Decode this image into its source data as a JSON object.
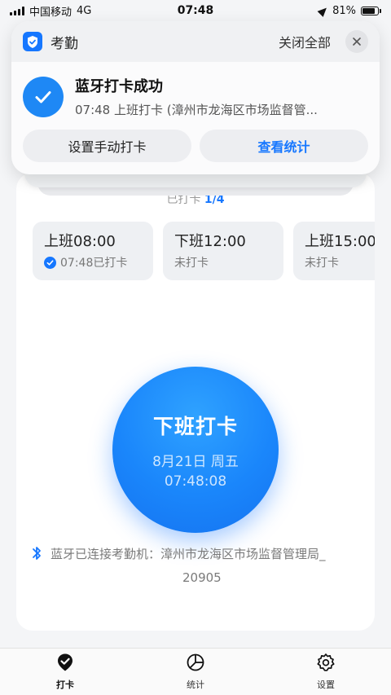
{
  "status_bar": {
    "carrier": "中国移动",
    "network": "4G",
    "time": "07:48",
    "battery": "81%",
    "battery_level": 0.81
  },
  "notification": {
    "app_name": "考勤",
    "close_all": "关闭全部",
    "title": "蓝牙打卡成功",
    "subtitle": "07:48 上班打卡 (漳州市龙海区市场监督管...",
    "button_manual": "设置手动打卡",
    "button_stats": "查看统计"
  },
  "main": {
    "progress_prefix": "已打卡",
    "progress_count": "1/4",
    "shifts": [
      {
        "time": "上班08:00",
        "status": "07:48已打卡",
        "done": true
      },
      {
        "time": "下班12:00",
        "status": "未打卡",
        "done": false
      },
      {
        "time": "上班15:00",
        "status": "未打卡",
        "done": false
      }
    ],
    "punch": {
      "label": "下班打卡",
      "date": "8月21日 周五",
      "clock": "07:48:08"
    },
    "bluetooth_line1": "蓝牙已连接考勤机：漳州市龙海区市场监督管理局_",
    "bluetooth_line2": "20905"
  },
  "tabs": [
    {
      "label": "打卡",
      "icon": "checkin-icon",
      "active": true
    },
    {
      "label": "统计",
      "icon": "pie-chart-icon",
      "active": false
    },
    {
      "label": "设置",
      "icon": "gear-icon",
      "active": false
    }
  ],
  "colors": {
    "accent": "#1677ff",
    "background": "#f4f5f7"
  }
}
